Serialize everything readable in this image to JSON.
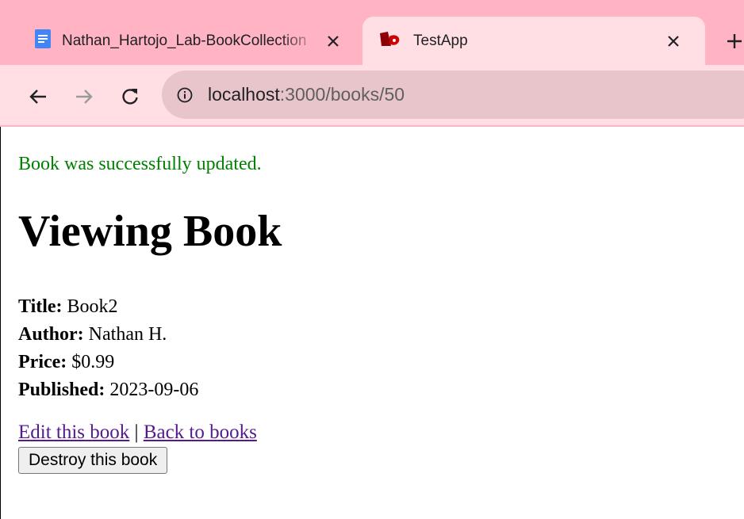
{
  "browser": {
    "tabs": [
      {
        "title": "Nathan_Hartojo_Lab-BookCollection",
        "icon": "docs-icon",
        "active": false
      },
      {
        "title": "TestApp",
        "icon": "app-favicon",
        "active": true
      }
    ],
    "address": {
      "host": "localhost",
      "rest": ":3000/books/50"
    }
  },
  "page": {
    "notice": "Book was successfully updated.",
    "heading": "Viewing Book",
    "book": {
      "title_label": "Title:",
      "title": "Book2",
      "author_label": "Author:",
      "author": "Nathan H.",
      "price_label": "Price:",
      "price": "$0.99",
      "published_label": "Published:",
      "published": "2023-09-06"
    },
    "links": {
      "edit": "Edit this book",
      "separator": "|",
      "back": "Back to books"
    },
    "destroy_button": "Destroy this book"
  },
  "colors": {
    "tabstrip": "#ffb3c3",
    "toolbar": "#ffdfe4",
    "omnibox": "#e8c5cb",
    "notice": "#008000",
    "link": "#551a8b"
  }
}
